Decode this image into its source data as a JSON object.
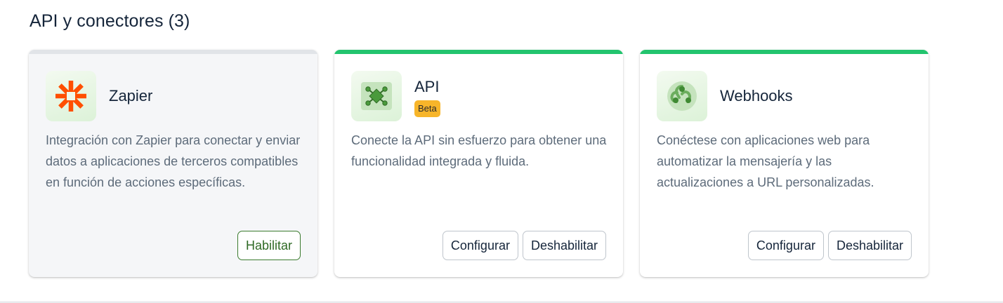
{
  "section": {
    "title": "API y conectores (3)"
  },
  "cards": [
    {
      "name": "Zapier",
      "badge": "",
      "description": "Integración con Zapier para conectar y enviar datos a aplicaciones de terceros compatibles en función de acciones específicas.",
      "status": "disabled",
      "buttons": [
        "Habilitar"
      ],
      "icon": "zapier-asterisk-icon"
    },
    {
      "name": "API",
      "badge": "Beta",
      "description": "Conecte la API sin esfuerzo para obtener una funcionalidad integrada y fluida.",
      "status": "enabled",
      "buttons": [
        "Configurar",
        "Deshabilitar"
      ],
      "icon": "api-nodes-icon"
    },
    {
      "name": "Webhooks",
      "badge": "",
      "description": "Conéctese con aplicaciones web para automatizar la mensajería y las actualizaciones a URL personalizadas.",
      "status": "enabled",
      "buttons": [
        "Configurar",
        "Deshabilitar"
      ],
      "icon": "webhook-icon"
    }
  ],
  "colors": {
    "enabled_bar": "#22c46e",
    "disabled_bar": "#e1e4e8",
    "badge_bg": "#f7b52a",
    "zapier_orange": "#ff4f00",
    "primary_green": "#3b7b2f"
  }
}
